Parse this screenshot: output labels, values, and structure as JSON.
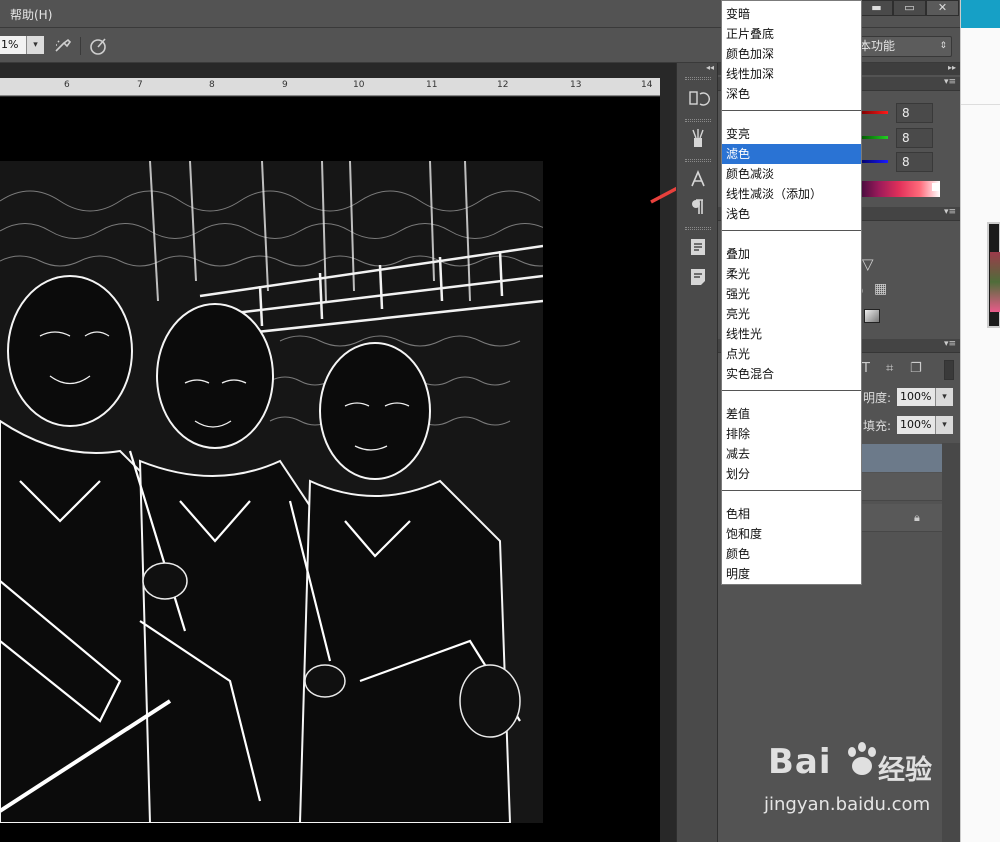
{
  "menubar": {
    "help": "帮助(H)"
  },
  "window_controls": {
    "minimize": "▬",
    "maximize": "▭",
    "close": "✕"
  },
  "options_bar": {
    "opacity_value": "1%",
    "dropdown_arrow": "▾",
    "airbrush_icon": "airbrush",
    "pressure_icon": "pressure"
  },
  "workspace": {
    "label": "本功能",
    "arrow": "⇕"
  },
  "ruler": {
    "ticks": [
      "6",
      "7",
      "8",
      "9",
      "10",
      "11",
      "12",
      "13",
      "14"
    ]
  },
  "dock": {
    "collapse": "◂◂"
  },
  "panels": {
    "expand": "▸▸",
    "color": {
      "r": "8",
      "g": "8",
      "b": "8"
    },
    "layers": {
      "opacity_label": "明度:",
      "opacity_value": "100%",
      "fill_label": "填充:",
      "fill_value": "100%",
      "tool_icons": [
        "T",
        "⌗",
        "❐"
      ]
    }
  },
  "blend_modes": {
    "groups": [
      [
        "变暗",
        "正片叠底",
        "颜色加深",
        "线性加深",
        "深色"
      ],
      [
        "变亮",
        "滤色",
        "颜色减淡",
        "线性减淡（添加）",
        "浅色"
      ],
      [
        "叠加",
        "柔光",
        "强光",
        "亮光",
        "线性光",
        "点光",
        "实色混合"
      ],
      [
        "差值",
        "排除",
        "减去",
        "划分"
      ],
      [
        "色相",
        "饱和度",
        "颜色",
        "明度"
      ]
    ],
    "selected": "滤色"
  },
  "watermark": {
    "brand": "Bai",
    "brand_cn": "经验",
    "url": "jingyan.baidu.com"
  },
  "colors": {
    "accent": "#2a73d4",
    "annotation_arrow": "#e8403c",
    "panel_bg": "#535353"
  }
}
